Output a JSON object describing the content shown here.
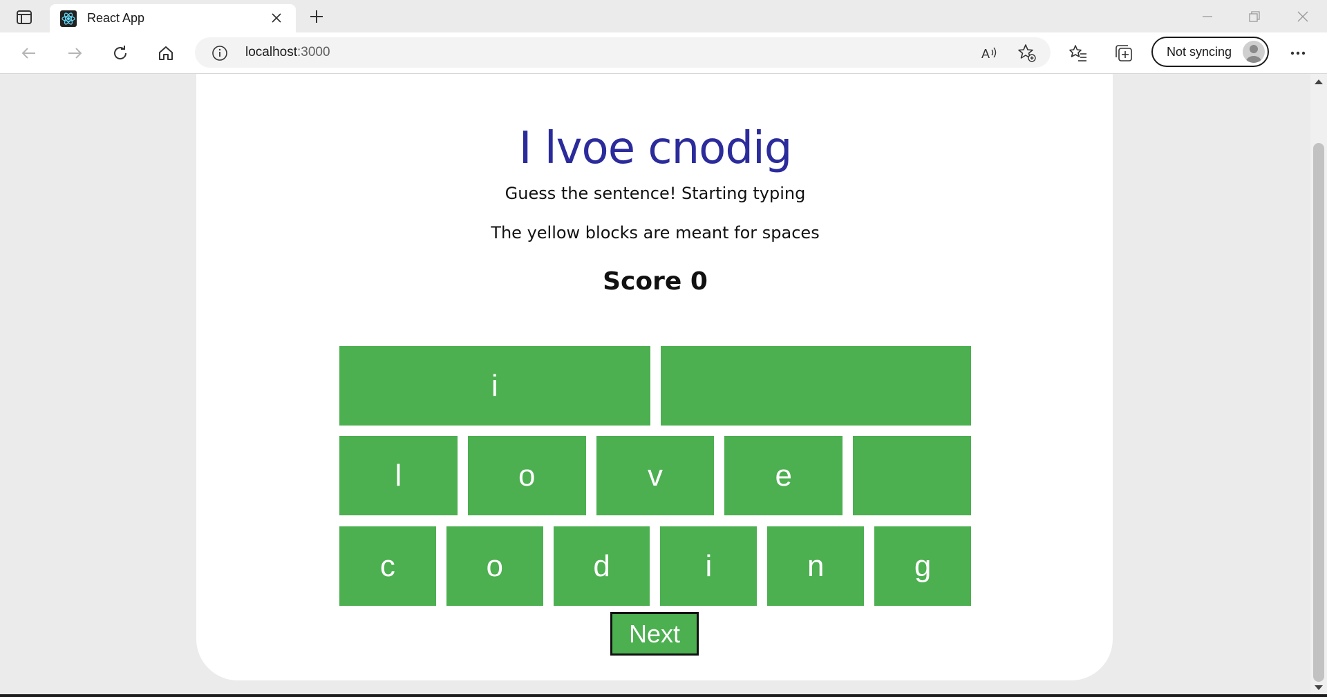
{
  "browser": {
    "tab_title": "React App",
    "address_host": "localhost",
    "address_port": ":3000",
    "sync_label": "Not syncing",
    "icons": {
      "sidebar": "tab-actions-icon",
      "favicon": "react-logo-icon",
      "close": "close-icon",
      "new_tab": "plus-icon",
      "back": "back-arrow-icon",
      "forward": "forward-arrow-icon",
      "refresh": "refresh-icon",
      "home": "home-icon",
      "info": "info-icon",
      "read_aloud": "read-aloud-icon",
      "add_favorite": "add-favorite-icon",
      "favorites": "favorites-icon",
      "collections": "collections-icon",
      "more": "more-icon"
    }
  },
  "game": {
    "title": "I lvoe cnodig",
    "instruction": "Guess the sentence! Starting typing",
    "hint": "The yellow blocks are meant for spaces",
    "score_label": "Score 0",
    "rows": [
      [
        "i",
        ""
      ],
      [
        "l",
        "o",
        "v",
        "e",
        ""
      ],
      [
        "c",
        "o",
        "d",
        "i",
        "n",
        "g"
      ]
    ],
    "next_label": "Next",
    "block_color": "#4caf50",
    "title_color": "#2b2b9c"
  }
}
